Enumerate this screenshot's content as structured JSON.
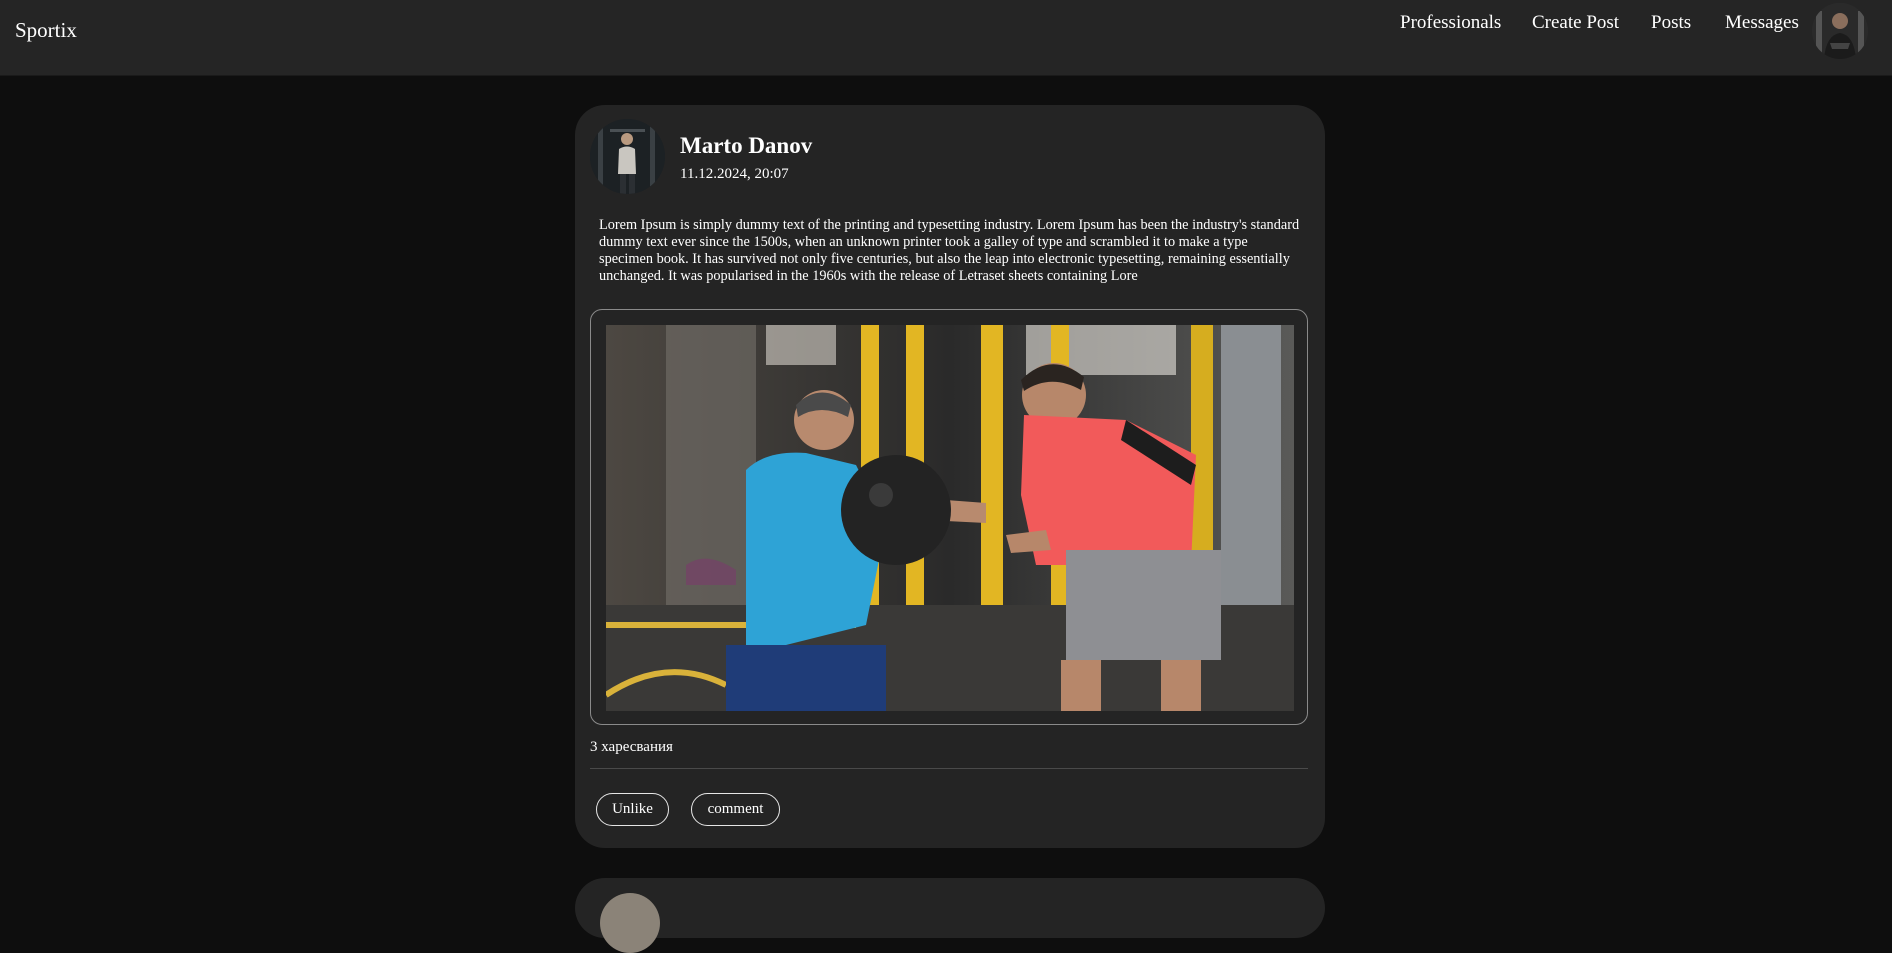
{
  "navbar": {
    "brand": "Sportix",
    "links": [
      {
        "label": "Professionals"
      },
      {
        "label": "Create Post"
      },
      {
        "label": "Posts"
      },
      {
        "label": "Messages"
      }
    ],
    "avatar_icon": "user-avatar"
  },
  "post": {
    "author": "Marto Danov",
    "date": "11.12.2024, 20:07",
    "body": "Lorem Ipsum is simply dummy text of the printing and typesetting industry. Lorem Ipsum has been the industry's standard dummy text ever since the 1500s, when an unknown printer took a galley of type and scrambled it to make a type specimen book. It has survived not only five centuries, but also the leap into electronic typesetting, remaining essentially unchanged. It was popularised in the 1960s with the release of Letraset sheets containing Lore",
    "likes": "3 харесвания",
    "unlike_label": "Unlike",
    "comment_label": "comment"
  },
  "colors": {
    "background": "#0e0e0e",
    "navbar": "#252525",
    "card": "#242424",
    "text": "#ffffff"
  }
}
